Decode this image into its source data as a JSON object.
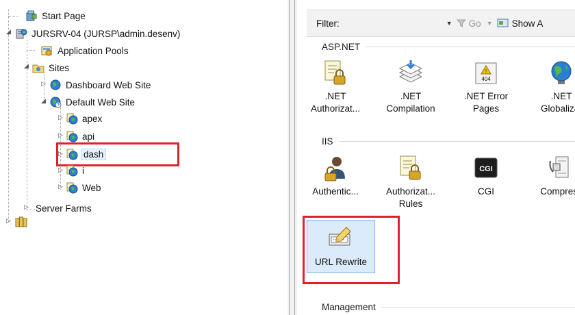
{
  "tree": {
    "nodes": [
      {
        "label": "Start Page",
        "icon": "start-page-icon"
      },
      {
        "label": "JURSRV-04 (JURSP\\admin.desenv)",
        "icon": "server-icon"
      },
      {
        "label": "Application Pools",
        "icon": "app-pools-icon"
      },
      {
        "label": "Sites",
        "icon": "sites-folder-icon"
      },
      {
        "label": "Dashboard Web Site",
        "icon": "globe-icon"
      },
      {
        "label": "Default Web Site",
        "icon": "globe-icon"
      },
      {
        "label": "apex",
        "icon": "web-app-icon"
      },
      {
        "label": "api",
        "icon": "web-app-icon"
      },
      {
        "label": "dash",
        "icon": "web-app-icon",
        "selected": true
      },
      {
        "label": "i",
        "icon": "web-app-icon"
      },
      {
        "label": "Web",
        "icon": "web-app-icon"
      },
      {
        "label": "Server Farms",
        "icon": ""
      },
      {
        "label": "",
        "icon": "farm-icon"
      }
    ]
  },
  "toolbar": {
    "filter_label": "Filter:",
    "filter_value": "",
    "go_label": "Go",
    "show_all_label": "Show A"
  },
  "groups": {
    "aspnet": "ASP.NET",
    "iis": "IIS",
    "management": "Management"
  },
  "features": {
    "net_authorization": {
      "line1": ".NET",
      "line2": "Authorizat...",
      "icon": "lock-document-icon"
    },
    "net_compilation": {
      "line1": ".NET",
      "line2": "Compilation",
      "icon": "compilation-stack-icon"
    },
    "net_error_pages": {
      "line1": ".NET Error",
      "line2": "Pages",
      "icon": "error-404-icon",
      "badge": "404"
    },
    "net_globalization": {
      "line1": ".NET",
      "line2": "Globalizat",
      "icon": "globe-icon"
    },
    "authentication": {
      "line1": "Authentic...",
      "icon": "user-lock-icon"
    },
    "authorization_rules": {
      "line1": "Authorizat...",
      "line2": "Rules",
      "icon": "lock-document-icon"
    },
    "cgi": {
      "line1": "CGI",
      "icon": "cgi-icon",
      "badge": "CGI"
    },
    "compression": {
      "line1": "Compress",
      "icon": "compression-icon"
    },
    "url_rewrite": {
      "line1": "URL Rewrite",
      "icon": "url-rewrite-icon",
      "selected": true
    }
  },
  "colors": {
    "highlight_red": "#e0202a",
    "selection_fill": "#dcebfb",
    "tree_selection": "#e5f1fb",
    "group_rule": "#cfdbe8"
  }
}
